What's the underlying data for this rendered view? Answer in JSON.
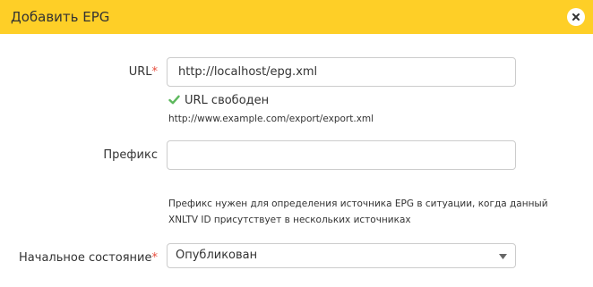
{
  "dialog": {
    "title": "Добавить EPG",
    "close_icon": "close-icon",
    "header_color": "#fecf27"
  },
  "url_field": {
    "label": "URL",
    "required_mark": "*",
    "value": "http://localhost/epg.xml",
    "status_text": "URL свободен",
    "status_icon": "check-icon",
    "status_color": "#5cb85c",
    "hint": "http://www.example.com/export/export.xml"
  },
  "prefix_field": {
    "label": "Префикс",
    "value": "",
    "help_line1": "Префикс нужен для определения источника EPG в ситуации, когда данный",
    "help_line2": "XNLTV ID присутствует в нескольких источниках"
  },
  "state_field": {
    "label": "Начальное состояние",
    "required_mark": "*",
    "selected": "Опубликован",
    "arrow_icon": "chevron-down-icon"
  }
}
